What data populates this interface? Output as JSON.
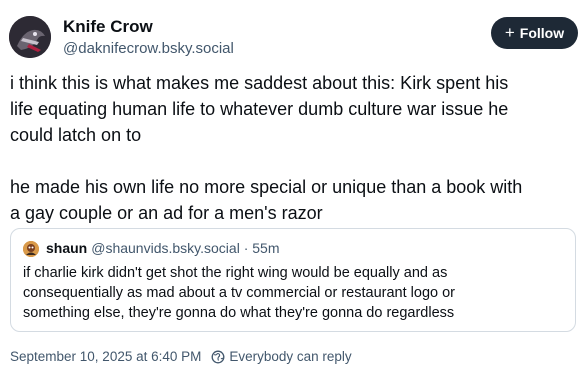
{
  "author": {
    "name": "Knife Crow",
    "handle": "@daknifecrow.bsky.social",
    "follow_label": "Follow",
    "avatar_icon": "crow-avatar"
  },
  "post": {
    "lines": [
      "i think this is what makes me saddest about this: Kirk spent his",
      "life equating human life to whatever dumb culture war issue he",
      "could latch on to",
      "",
      "he made his own life no more special or unique than a book with",
      "a gay couple or an ad for a men's razor"
    ]
  },
  "quote": {
    "name": "shaun",
    "handle": "@shaunvids.bsky.social",
    "time": " · 55m",
    "avatar_icon": "shaun-avatar",
    "lines": [
      "if charlie kirk didn't get shot the right wing would be equally and as",
      "consequentially as mad about a tv commercial or restaurant logo or",
      "something else, they're gonna do what they're gonna do regardless"
    ]
  },
  "footer": {
    "timestamp": "September 10, 2025 at 6:40 PM",
    "reply_setting": "Everybody can reply",
    "reply_icon": "globe-icon"
  },
  "colors": {
    "follow_bg": "#1e2936",
    "muted_text": "#42576c",
    "border": "#d4dbe2"
  }
}
